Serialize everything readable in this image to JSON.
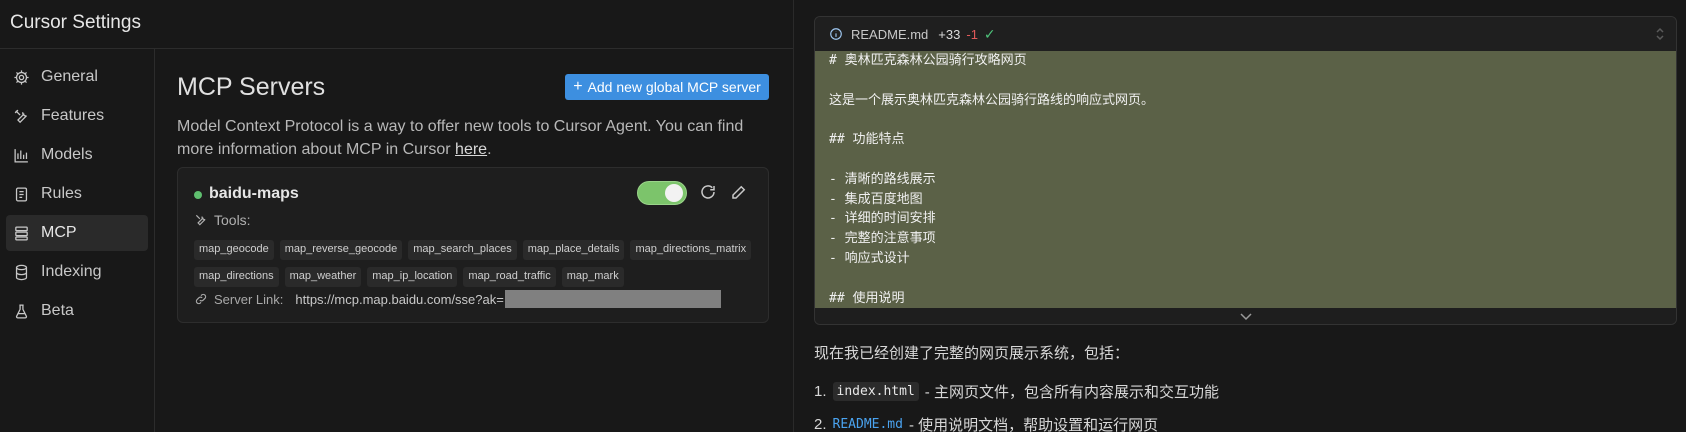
{
  "settings": {
    "title": "Cursor Settings",
    "nav": [
      {
        "label": "General",
        "icon": "gear-icon"
      },
      {
        "label": "Features",
        "icon": "tools-icon"
      },
      {
        "label": "Models",
        "icon": "chart-icon"
      },
      {
        "label": "Rules",
        "icon": "document-icon"
      },
      {
        "label": "MCP",
        "icon": "server-icon",
        "active": true
      },
      {
        "label": "Indexing",
        "icon": "database-icon"
      },
      {
        "label": "Beta",
        "icon": "flask-icon"
      }
    ],
    "mcp": {
      "title": "MCP Servers",
      "add_button": "Add new global MCP server",
      "description_prefix": "Model Context Protocol is a way to offer new tools to Cursor Agent. You can find more information about MCP in Cursor ",
      "description_link": "here",
      "description_suffix": ".",
      "server": {
        "name": "baidu-maps",
        "enabled": true,
        "status_color": "#5fbf6f",
        "tools_label": "Tools:",
        "tools": [
          "map_geocode",
          "map_reverse_geocode",
          "map_search_places",
          "map_place_details",
          "map_directions_matrix",
          "map_directions",
          "map_weather",
          "map_ip_location",
          "map_road_traffic",
          "map_mark"
        ],
        "link_label": "Server Link:",
        "link_url": "https://mcp.map.baidu.com/sse?ak="
      }
    }
  },
  "chat": {
    "file": {
      "name": "README.md",
      "added": "+33",
      "removed": "-1",
      "lines": [
        "# 奥林匹克森林公园骑行攻略网页",
        "",
        "这是一个展示奥林匹克森林公园骑行路线的响应式网页。",
        "",
        "## 功能特点",
        "",
        "- 清晰的路线展示",
        "- 集成百度地图",
        "- 详细的时间安排",
        "- 完整的注意事项",
        "- 响应式设计",
        "",
        "## 使用说明"
      ]
    },
    "message": "现在我已经创建了完整的网页展示系统，包括：",
    "list": [
      {
        "num": "1.",
        "code": "index.html",
        "text": "- 主网页文件，包含所有内容展示和交互功能"
      },
      {
        "num": "2.",
        "code": "README.md",
        "text": "- 使用说明文档，帮助设置和运行网页"
      }
    ]
  }
}
